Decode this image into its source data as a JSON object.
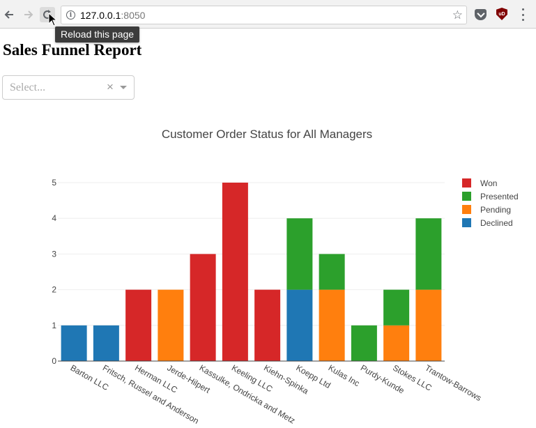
{
  "browser": {
    "url_host": "127.0.0.1",
    "url_port": ":8050",
    "tooltip": "Reload this page",
    "icons": {
      "back": "arrow-left-icon",
      "forward": "arrow-right-icon",
      "reload": "reload-icon",
      "info": "info-icon",
      "bookmark": "star-icon",
      "pocket": "pocket-icon",
      "ublock": "ublock-icon",
      "menu": "kebab-menu-icon"
    },
    "ublock_label": "uD"
  },
  "page": {
    "title": "Sales Funnel Report",
    "select": {
      "placeholder": "Select...",
      "clear_symbol": "×"
    }
  },
  "colors": {
    "Won": "#d62728",
    "Presented": "#2ca02c",
    "Pending": "#ff7f0e",
    "Declined": "#1f77b4"
  },
  "chart_data": {
    "type": "bar",
    "stacked": true,
    "title": "Customer Order Status for All Managers",
    "xlabel": "",
    "ylabel": "",
    "ylim": [
      0,
      5
    ],
    "yticks": [
      0,
      1,
      2,
      3,
      4,
      5
    ],
    "grid": true,
    "legend_position": "top-right",
    "categories": [
      "Barton LLC",
      "Fritsch, Russel and Anderson",
      "Herman LLC",
      "Jerde-Hilpert",
      "Kassulke, Ondricka and Metz",
      "Keeling LLC",
      "Kiehn-Spinka",
      "Koepp Ltd",
      "Kulas Inc",
      "Purdy-Kunde",
      "Stokes LLC",
      "Trantow-Barrows"
    ],
    "series": [
      {
        "name": "Declined",
        "color": "#1f77b4",
        "values": [
          1,
          1,
          0,
          0,
          0,
          0,
          0,
          2,
          0,
          0,
          0,
          0
        ]
      },
      {
        "name": "Pending",
        "color": "#ff7f0e",
        "values": [
          0,
          0,
          0,
          2,
          0,
          0,
          0,
          0,
          2,
          0,
          1,
          2
        ]
      },
      {
        "name": "Presented",
        "color": "#2ca02c",
        "values": [
          0,
          0,
          0,
          0,
          0,
          0,
          0,
          2,
          1,
          1,
          1,
          2
        ]
      },
      {
        "name": "Won",
        "color": "#d62728",
        "values": [
          0,
          0,
          2,
          0,
          3,
          5,
          2,
          0,
          0,
          0,
          0,
          0
        ]
      }
    ],
    "legend_order": [
      "Won",
      "Presented",
      "Pending",
      "Declined"
    ]
  }
}
